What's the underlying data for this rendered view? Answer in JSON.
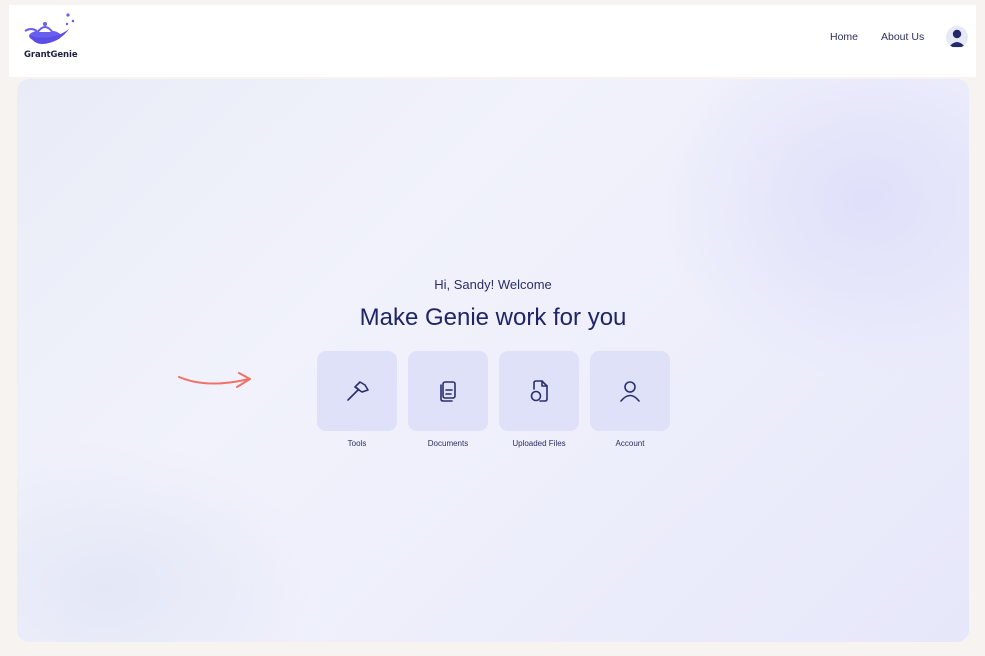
{
  "brand": {
    "name": "GrantGenie",
    "logo_icon": "genie-lamp-icon",
    "accent_color": "#6a5ef0"
  },
  "nav": {
    "links": [
      {
        "label": "Home"
      },
      {
        "label": "About Us"
      }
    ],
    "avatar_icon": "user-avatar-icon"
  },
  "hero": {
    "greeting": "Hi, Sandy! Welcome",
    "headline": "Make Genie work for you",
    "arrow_icon": "arrow-right-icon",
    "arrow_color": "#f0706a"
  },
  "tiles": [
    {
      "label": "Tools",
      "icon": "hammer-icon"
    },
    {
      "label": "Documents",
      "icon": "documents-icon"
    },
    {
      "label": "Uploaded Files",
      "icon": "uploaded-file-icon"
    },
    {
      "label": "Account",
      "icon": "user-icon"
    }
  ],
  "colors": {
    "tile_bg": "#dfe1f8",
    "text_dark": "#1f2467",
    "page_bg": "#f7f3f1"
  }
}
